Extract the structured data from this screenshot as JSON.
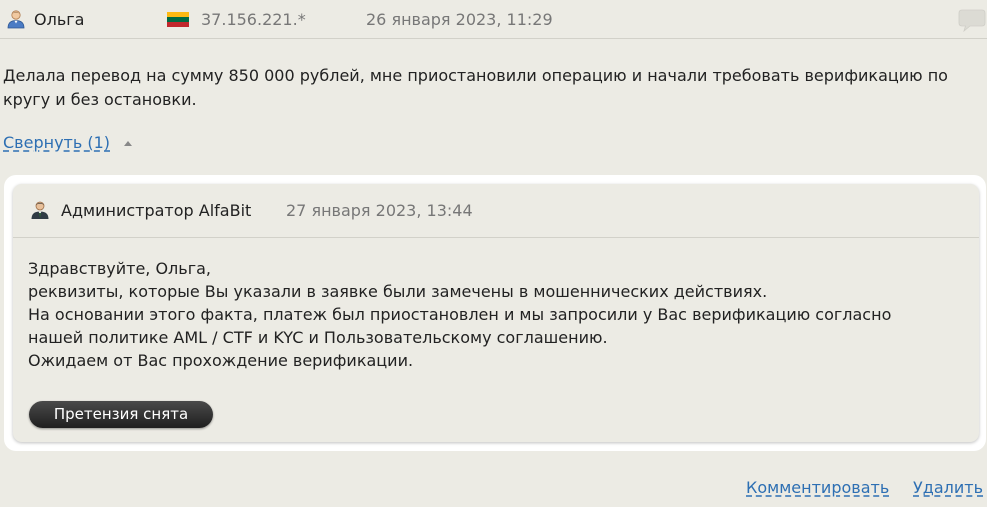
{
  "comment": {
    "author": "Ольга",
    "ip": "37.156.221.*",
    "date": "26 января 2023, 11:29",
    "text": "Делала перевод на сумму 850 000 рублей, мне приостановили операцию и начали требовать верификацию по кругу и без остановки.",
    "collapse_label": "Свернуть (1)"
  },
  "reply": {
    "author": "Администратор AlfaBit",
    "date": "27 января 2023, 13:44",
    "lines": [
      "Здравствуйте, Ольга,",
      "реквизиты, которые Вы указали в заявке были замечены в мошеннических действиях.",
      "На основании этого факта, платеж был приостановлен и мы запросили у Вас верификацию согласно",
      "нашей политике AML / CTF и KYC и Пользовательскому соглашению.",
      "Ожидаем от Вас прохождение верификации."
    ],
    "status_badge": "Претензия снята"
  },
  "actions": {
    "comment": "Комментировать",
    "delete": "Удалить"
  },
  "icons": {
    "author": "user-icon",
    "flag": "flag-icon",
    "bubble": "speech-bubble-icon",
    "admin": "admin-icon",
    "collapse": "caret-up-icon"
  },
  "colors": {
    "background": "#ecebe4",
    "link": "#2d6fb3",
    "muted_text": "#777777",
    "badge": "#2a2a2a"
  }
}
